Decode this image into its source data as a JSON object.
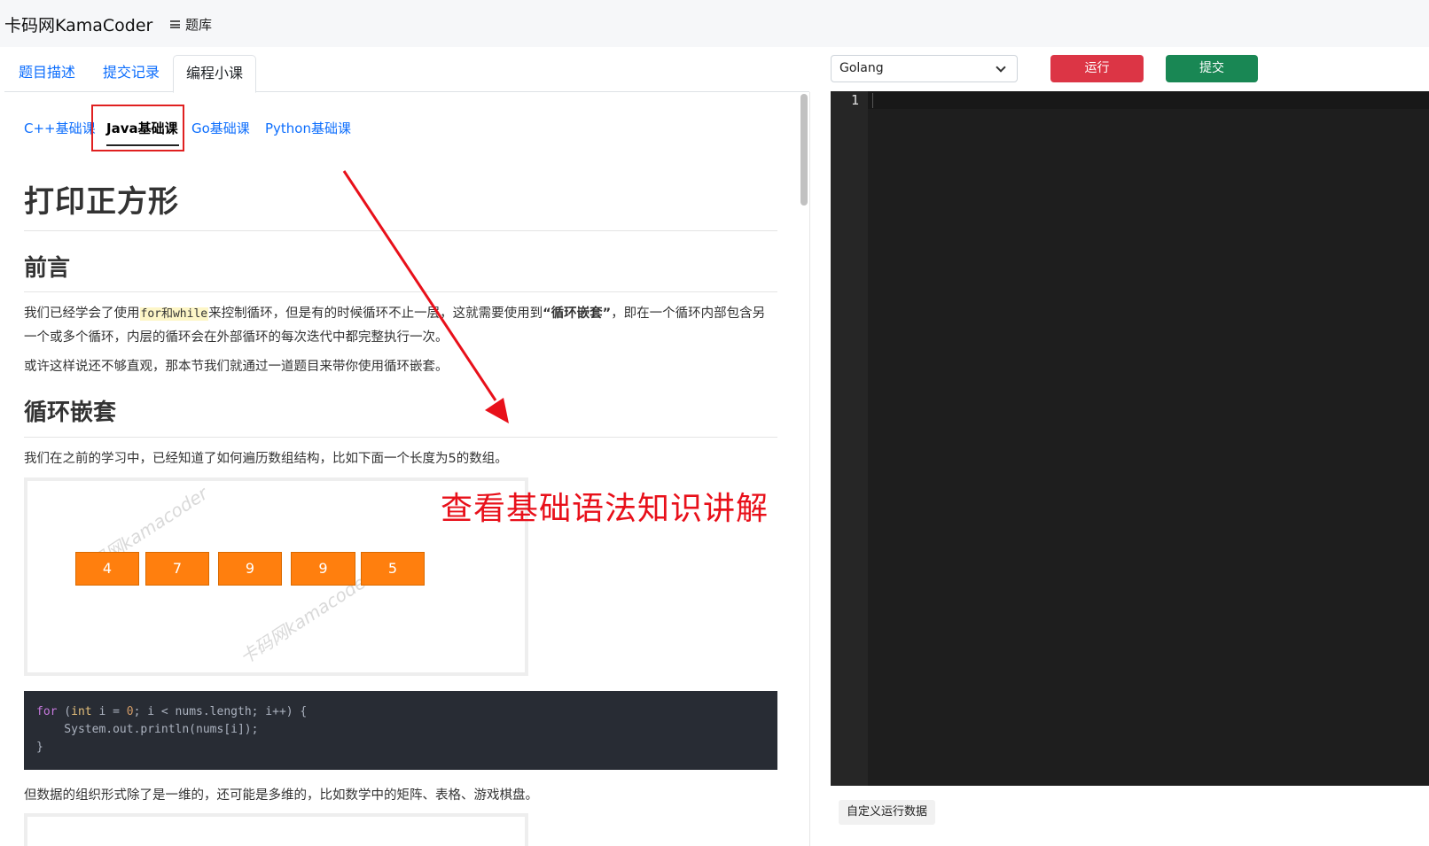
{
  "header": {
    "brand": "卡码网KamaCoder",
    "nav_problemset": "题库"
  },
  "tabs": [
    {
      "label": "题目描述"
    },
    {
      "label": "提交记录"
    },
    {
      "label": "编程小课",
      "active": true
    }
  ],
  "subtabs": [
    {
      "label": "C++基础课"
    },
    {
      "label": "Java基础课",
      "active": true
    },
    {
      "label": "Go基础课"
    },
    {
      "label": "Python基础课"
    }
  ],
  "article": {
    "title": "打印正方形",
    "sections": [
      {
        "heading": "前言"
      },
      {
        "heading": "循环嵌套"
      }
    ],
    "intro_p1_a": "我们已经学会了使用",
    "intro_p1_code": "for和while",
    "intro_p1_b": "来控制循环，但是有的时候循环不止一层，这就需要使用到",
    "intro_p1_bold": "“循环嵌套”",
    "intro_p1_c": "，即在一个循环内部包含另一个或多个循环，内层的循环会在外部循环的每次迭代中都完整执行一次。",
    "intro_p2": "或许这样说还不够直观，那本节我们就通过一道题目来带你使用循环嵌套。",
    "nested_p1": "我们在之前的学习中，已经知道了如何遍历数组结构，比如下面一个长度为5的数组。",
    "array_values": [
      "4",
      "7",
      "9",
      "9",
      "5"
    ],
    "watermark": "卡码网kamacoder",
    "code": {
      "l1_kw": "for",
      "l1_a": " (",
      "l1_type": "int",
      "l1_b": " i = ",
      "l1_num": "0",
      "l1_c": "; i < nums.length; i++) {",
      "l2": "    System.out.println(nums[i]);",
      "l3": "}"
    },
    "nested_p2": "但数据的组织形式除了是一维的，还可能是多维的，比如数学中的矩阵、表格、游戏棋盘。"
  },
  "annotation": {
    "text": "查看基础语法知识讲解",
    "color": "#e8101a"
  },
  "editor": {
    "language": "Golang",
    "run_label": "运行",
    "submit_label": "提交",
    "line_numbers": [
      "1"
    ],
    "custom_data_label": "自定义运行数据"
  },
  "colors": {
    "link": "#0d6efd",
    "run": "#dc3545",
    "submit": "#198754",
    "array_cell": "#ff7f0e",
    "editor_bg": "#1e1e1e"
  }
}
